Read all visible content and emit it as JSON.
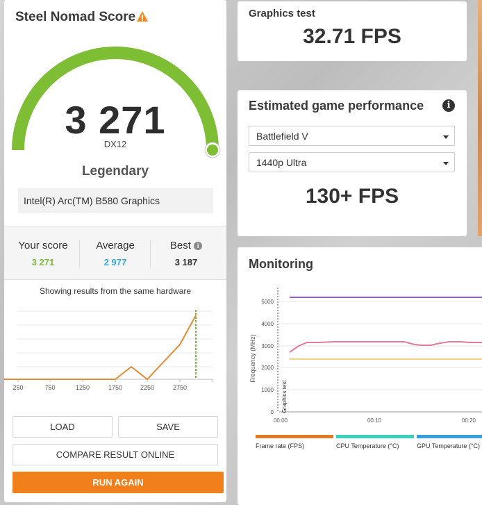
{
  "score_card": {
    "title": "Steel Nomad Score",
    "warning_icon": "warning-triangle-icon",
    "score": "3 271",
    "api": "DX12",
    "tier": "Legendary",
    "gauge_fraction": 0.93,
    "gpu": "Intel(R) Arc(TM) B580 Graphics",
    "stats": {
      "your_label": "Your score",
      "your_value": "3 271",
      "your_color": "#7ab83a",
      "avg_label": "Average",
      "avg_value": "2 977",
      "avg_color": "#3aa8d8",
      "best_label": "Best",
      "best_value": "3 187"
    },
    "hardware_note": "Showing results from the same hardware",
    "distribution": {
      "x_ticks": [
        "250",
        "750",
        "1250",
        "1750",
        "2250",
        "2750"
      ],
      "line_color": "#e58a35",
      "marker_color": "#7ab83a"
    },
    "buttons": {
      "load": "LOAD",
      "save": "SAVE",
      "compare": "COMPARE RESULT ONLINE",
      "run_again": "RUN AGAIN"
    }
  },
  "graphics_test": {
    "label": "Graphics test",
    "value": "32.71 FPS"
  },
  "estimated": {
    "title": "Estimated game performance",
    "game": "Battlefield V",
    "preset": "1440p Ultra",
    "fps": "130+ FPS"
  },
  "monitoring": {
    "title": "Monitoring",
    "y_label": "Frequency (MHz)",
    "y_ticks": [
      "5000",
      "4000",
      "3000",
      "2000",
      "1000",
      "0"
    ],
    "x_ticks": [
      "00:00",
      "00:10",
      "00:20"
    ],
    "phase_label": "Graphics test",
    "legend": [
      {
        "label": "Frame rate (FPS)",
        "color": "#e07b2a"
      },
      {
        "label": "CPU Temperature (°C)",
        "color": "#3ccfc0"
      },
      {
        "label": "GPU Temperature (°C)",
        "color": "#3a9de0"
      }
    ],
    "series_colors": {
      "cpu_clock": "#9b59d0",
      "gpu_clock": "#e07aa0",
      "gpu_mem": "#e8c35a"
    }
  }
}
